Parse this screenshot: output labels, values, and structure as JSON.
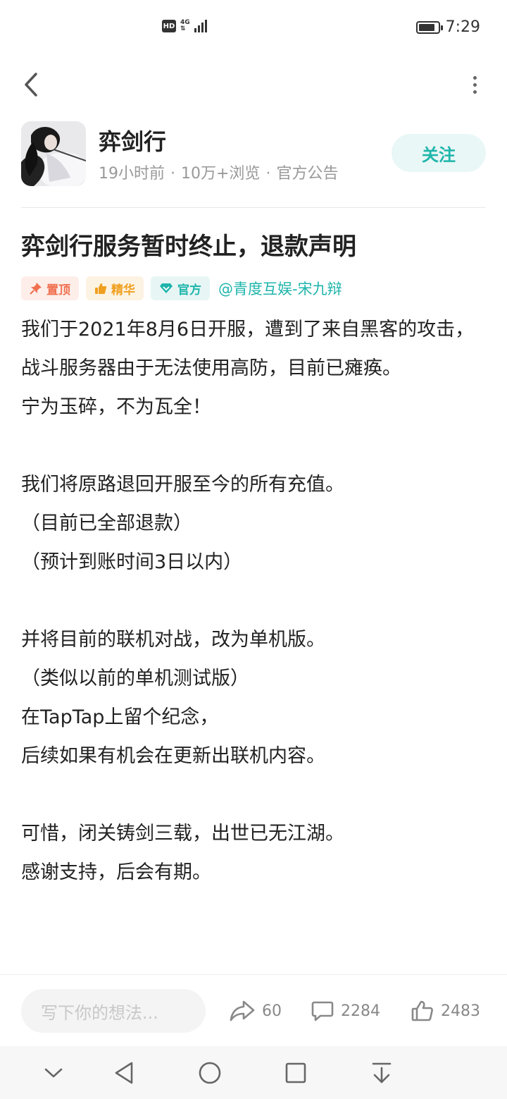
{
  "status_bar": {
    "hd": "HD",
    "network": "4G",
    "time": "7:29"
  },
  "author": {
    "name": "弈剑行",
    "time_ago": "19小时前",
    "views": "10万+浏览",
    "category": "官方公告",
    "follow_label": "关注"
  },
  "post": {
    "title": "弈剑行服务暂时终止，退款声明",
    "tags": {
      "pin": "置顶",
      "best": "精华",
      "official": "官方"
    },
    "mention": "@青度互娱-宋九辩",
    "body": [
      "我们于2021年8月6日开服，遭到了来自黑客的攻击，战斗服务器由于无法使用高防，目前已瘫痪。",
      "宁为玉碎，不为瓦全！",
      "",
      "我们将原路退回开服至今的所有充值。",
      "（目前已全部退款）",
      "（预计到账时间3日以内）",
      "",
      "并将目前的联机对战，改为单机版。",
      "（类似以前的单机测试版）",
      "在TapTap上留个纪念，",
      "后续如果有机会在更新出联机内容。",
      "",
      "可惜，闭关铸剑三载，出世已无江湖。",
      "感谢支持，后会有期。"
    ]
  },
  "bottom_bar": {
    "comment_placeholder": "写下你的想法...",
    "share_count": "60",
    "comment_count": "2284",
    "like_count": "2483"
  },
  "colors": {
    "accent": "#1fb5ab",
    "pin": "#f07050",
    "best": "#f0a020"
  }
}
